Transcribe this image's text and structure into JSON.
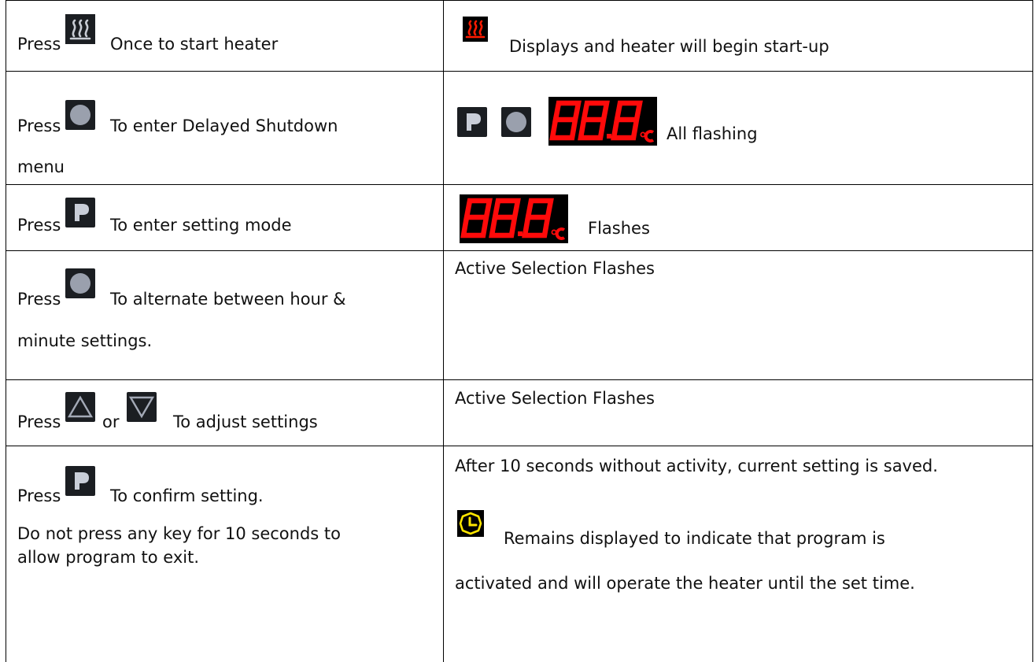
{
  "rows": [
    {
      "left": {
        "t1": "Press",
        "t2": "Once to start heater"
      },
      "right": {
        "t1": "Displays and heater will begin start-up"
      },
      "icons": {
        "left": "heater-button-icon",
        "right": "heater-active-indicator-icon"
      }
    },
    {
      "left": {
        "t1": "Press",
        "t2": "To enter Delayed Shutdown",
        "t3": "menu"
      },
      "right": {
        "t1": "All flashing"
      },
      "icons": {
        "left": "circle-button-icon",
        "right": [
          "p-button-icon",
          "circle-button-icon",
          "led-display-888-celsius"
        ]
      }
    },
    {
      "left": {
        "t1": "Press",
        "t2": "To enter setting mode"
      },
      "right": {
        "t1": "Flashes"
      },
      "icons": {
        "left": "p-button-icon",
        "right": "led-display-888-celsius"
      }
    },
    {
      "left": {
        "t1": "Press",
        "t2": "To alternate between hour &",
        "t3": "minute settings."
      },
      "right": {
        "t1": "Active Selection Flashes"
      },
      "icons": {
        "left": "circle-button-icon"
      }
    },
    {
      "left": {
        "t1": "Press",
        "t2": "or",
        "t3": "To adjust settings"
      },
      "right": {
        "t1": "Active Selection Flashes"
      },
      "icons": {
        "left": [
          "up-arrow-button-icon",
          "down-arrow-button-icon"
        ]
      }
    },
    {
      "left": {
        "t1": "Press",
        "t2": "To confirm setting.",
        "t3": "Do not press any key for 10 seconds to",
        "t4": "allow program to exit."
      },
      "right": {
        "t1": "After 10 seconds without activity, current setting is saved.",
        "t2": "Remains displayed to indicate that program is",
        "t3": "activated and will operate the heater until the set time."
      },
      "icons": {
        "left": "p-button-icon",
        "right": "clock-timer-icon"
      }
    }
  ],
  "colors": {
    "led_red": "#ff0a0a",
    "button_dark": "#1b1e22",
    "button_gray": "#9aa0ad",
    "clock_yellow": "#ffe600",
    "heater_red": "#ff1a00"
  }
}
